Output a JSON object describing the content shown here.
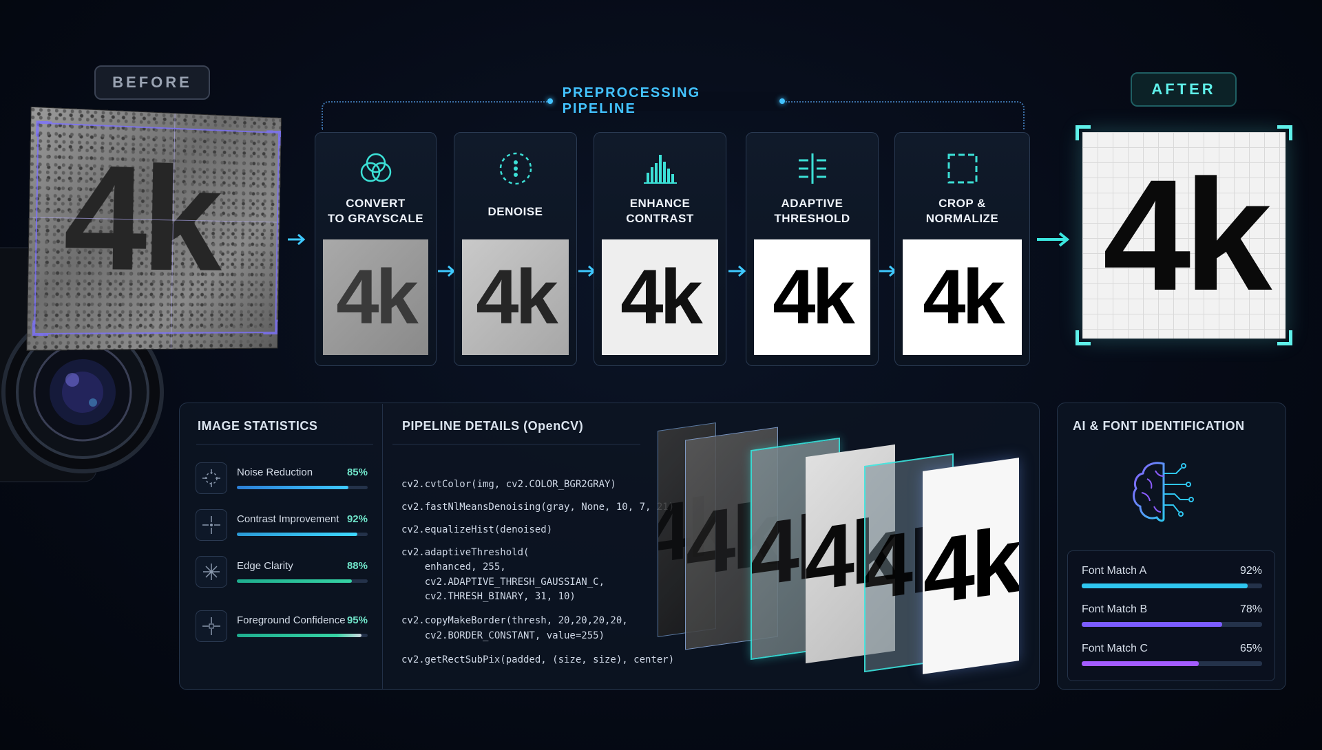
{
  "labels": {
    "before": "BEFORE",
    "after": "AFTER",
    "pipeline": "PREPROCESSING PIPELINE"
  },
  "steps": [
    {
      "label": "CONVERT\nTO GRAYSCALE",
      "icon": "color-circles-icon",
      "sample": "4k"
    },
    {
      "label": "DENOISE",
      "icon": "denoise-dots-icon",
      "sample": "4k"
    },
    {
      "label": "ENHANCE\nCONTRAST",
      "icon": "histogram-icon",
      "sample": "4k"
    },
    {
      "label": "ADAPTIVE\nTHRESHOLD",
      "icon": "threshold-icon",
      "sample": "4k"
    },
    {
      "label": "CROP &\nNORMALIZE",
      "icon": "crop-icon",
      "sample": "4k"
    }
  ],
  "before_sample": "4k",
  "after_sample": "4k",
  "stats": {
    "title": "IMAGE STATISTICS",
    "items": [
      {
        "name": "Noise Reduction",
        "value": "85%",
        "fraction": 0.85,
        "icon": "crosshair-icon"
      },
      {
        "name": "Contrast Improvement",
        "value": "92%",
        "fraction": 0.92,
        "icon": "crosshair-icon"
      },
      {
        "name": "Edge Clarity",
        "value": "88%",
        "fraction": 0.88,
        "icon": "sparkle-icon"
      },
      {
        "name": "Foreground Confidence",
        "value": "95%",
        "fraction": 0.95,
        "icon": "crosshair-icon"
      }
    ]
  },
  "pipeline_details": {
    "title": "PIPELINE DETAILS (OpenCV)",
    "code_lines": [
      "cv2.cvtColor(img, cv2.COLOR_BGR2GRAY)",
      "cv2.fastNlMeansDenoising(gray, None, 10, 7, 21)",
      "cv2.equalizeHist(denoised)",
      "cv2.adaptiveThreshold(",
      "    enhanced, 255,",
      "    cv2.ADAPTIVE_THRESH_GAUSSIAN_C,",
      "    cv2.THRESH_BINARY, 31, 10)",
      "cv2.copyMakeBorder(thresh, 20,20,20,20,",
      "    cv2.BORDER_CONSTANT, value=255)",
      "cv2.getRectSubPix(padded, (size, size), center)"
    ],
    "layer_samples": [
      "4k",
      "4k",
      "4k",
      "4k",
      "4k",
      "4k"
    ]
  },
  "ai": {
    "title": "AI & FONT IDENTIFICATION",
    "icon": "brain-circuit-icon",
    "matches": [
      {
        "name": "Font Match A",
        "value": "92%",
        "fraction": 0.92,
        "color": "#2fc6f0"
      },
      {
        "name": "Font Match B",
        "value": "78%",
        "fraction": 0.78,
        "color": "#7b5cff"
      },
      {
        "name": "Font Match C",
        "value": "65%",
        "fraction": 0.65,
        "color": "#a35cff"
      }
    ]
  },
  "colors": {
    "accent_blue": "#43c3ff",
    "accent_cyan": "#5ff0ea",
    "stat_green": "#36d3a4",
    "purple": "#7b70ff"
  }
}
